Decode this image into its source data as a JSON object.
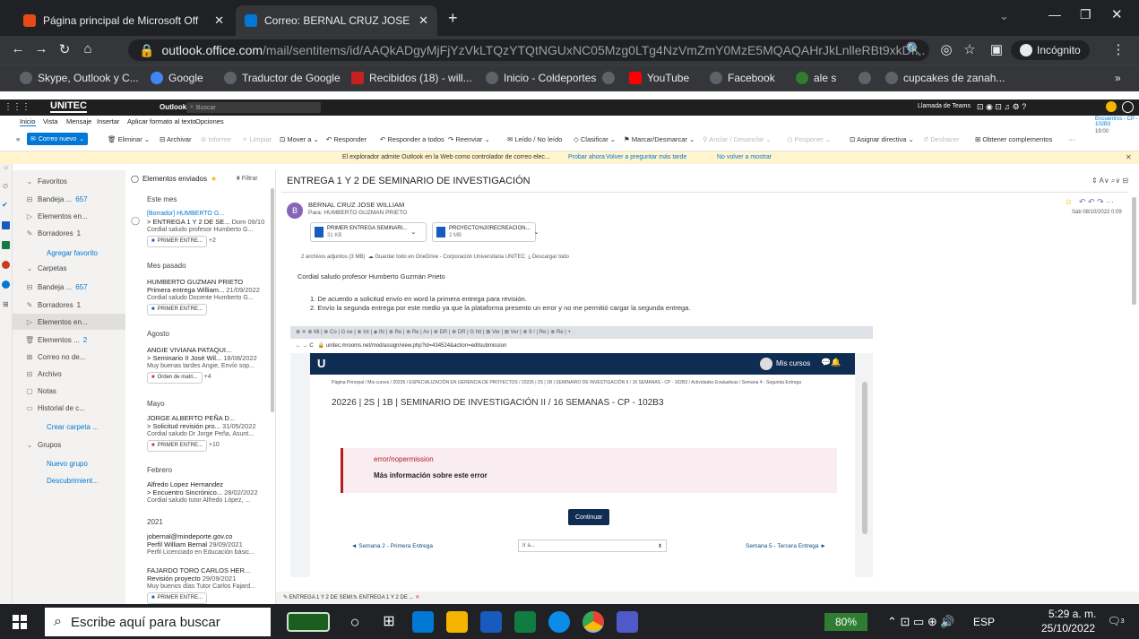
{
  "chrome": {
    "tabs": [
      {
        "title": "Página principal de Microsoft Off",
        "icon": "office-icon"
      },
      {
        "title": "Correo: BERNAL CRUZ JOSE WILL",
        "icon": "outlook-icon"
      }
    ],
    "new_tab": "+",
    "address_host": "outlook.office.com",
    "address_path": "/mail/sentitems/id/AAQkADgyMjFjYzVkLTQzYTQtNGUxNC05Mzg0LTg4NzVmZmY0MzE5MQAQAHrJkLnlleRBt9xkDf...",
    "profile": "Incógnito",
    "bookmarks": [
      "Skype, Outlook y C...",
      "Google",
      "Traductor de Google",
      "Recibidos (18) - will...",
      "Inicio - Coldeportes",
      "YouTube",
      "Facebook",
      "ale s",
      "cupcakes de zanah..."
    ],
    "bookmarks_more": "»"
  },
  "outlook": {
    "brand": "UNITEC",
    "app": "Outlook",
    "search_placeholder": "Buscar",
    "teams_call": "Llamada de Teams",
    "menu_tabs": [
      "Inicio",
      "Vista",
      "Mensaje",
      "Insertar",
      "Aplicar formato al texto",
      "Opciones"
    ],
    "new_mail": "Correo nuevo",
    "ribbon": [
      "Eliminar",
      "Archivar",
      "Informe",
      "Limpiar",
      "Mover a",
      "Responder",
      "Responder a todos",
      "Reenviar",
      "Leído / No leído",
      "Clasificar",
      "Marcar/Desmarcar",
      "Anclar / Desanclar",
      "Posponer",
      "Asignar directiva",
      "Deshacer",
      "Obtener complementos"
    ],
    "reminder": "Encuentros - CP - 102B3",
    "reminder_time": "19:00",
    "info_text": "El explorador admite Outlook en la Web como controlador de correo elec...",
    "info_links": [
      "Probar ahora",
      "Volver a preguntar más tarde",
      "No volver a mostrar"
    ],
    "folders": {
      "favorites_label": "Favoritos",
      "fav_items": [
        {
          "label": "Bandeja ...",
          "count": "657"
        },
        {
          "label": "Elementos en...",
          "count": ""
        },
        {
          "label": "Borradores",
          "count": "1"
        }
      ],
      "add_favorite": "Agregar favorito",
      "carpetas_label": "Carpetas",
      "folder_items": [
        {
          "label": "Bandeja ...",
          "count": "657"
        },
        {
          "label": "Borradores",
          "count": "1"
        },
        {
          "label": "Elementos en...",
          "count": ""
        },
        {
          "label": "Elementos ...",
          "count": "2"
        },
        {
          "label": "Correo no de...",
          "count": ""
        },
        {
          "label": "Archivo",
          "count": ""
        },
        {
          "label": "Notas",
          "count": ""
        },
        {
          "label": "Historial de c...",
          "count": ""
        }
      ],
      "create_folder": "Crear carpeta ...",
      "groups_label": "Grupos",
      "new_group": "Nuevo grupo",
      "discover": "Descubrimient..."
    },
    "list": {
      "header": "Elementos enviados",
      "filter": "Filtrar",
      "groups": [
        "Este mes",
        "Mes pasado",
        "Agosto",
        "Mayo",
        "Febrero",
        "2021"
      ],
      "items": [
        {
          "from": "[Borrador] HUMBERTO G...",
          "subject": "> ENTREGA 1 Y 2 DE SE...",
          "date": "Dom 09/10",
          "preview": "Cordial saludo profesor Humberto G...",
          "attach": "PRIMER ENTRE...",
          "extra": "+2"
        },
        {
          "from": "HUMBERTO GUZMAN PRIETO",
          "subject": "Primera entrega William...",
          "date": "21/09/2022",
          "preview": "Cordial saludo Docente Humberto G...",
          "attach": "PRIMER ENTRE...",
          "extra": ""
        },
        {
          "from": "ANGIE VIVIANA PATAQUI...",
          "subject": "> Seminario II José Wil...",
          "date": "18/08/2022",
          "preview": "Muy buenas tardes Angie, Envío sop...",
          "attach": "Orden de matri...",
          "extra": "+4"
        },
        {
          "from": "JORGE ALBERTO PEÑA D...",
          "subject": "> Solicitud revisión pro...",
          "date": "31/05/2022",
          "preview": "Cordial saludo Dr Jorge Peña, Asunt...",
          "attach": "PRIMER ENTRE...",
          "extra": "+10"
        },
        {
          "from": "Alfredo Lopez Hernandez",
          "subject": "> Encuentro Sincrónico...",
          "date": "28/02/2022",
          "preview": "Cordial saludo tutor Alfredo López, ...",
          "attach": "",
          "extra": ""
        },
        {
          "from": "jobernal@mindeporte.gov.co",
          "subject": "Perfil William Bernal",
          "date": "29/09/2021",
          "preview": "Perfil Licenciado en Educación básic...",
          "attach": "",
          "extra": ""
        },
        {
          "from": "FAJARDO TORO CARLOS HER...",
          "subject": "Revisión proyecto",
          "date": "29/09/2021",
          "preview": "Muy buenos días Tutor Carlos Fajard...",
          "attach": "PRIMER ENTRE...",
          "extra": ""
        }
      ]
    },
    "reading": {
      "subject": "ENTREGA 1 Y 2 DE SEMINARIO DE INVESTIGACIÓN",
      "sender": "BERNAL CRUZ JOSE WILLIAM",
      "avatar": "B",
      "to": "Para: HUMBERTO GUZMAN PRIETO",
      "date": "Sáb 08/10/2022 0:09",
      "attachments": [
        {
          "name": "PRIMER ENTREGA SEMINARI...",
          "size": "31 KB"
        },
        {
          "name": "PROYECTO%20RECREACION...",
          "size": "2 MB"
        }
      ],
      "attach_summary": "2 archivos adjuntos (3 MB)",
      "save_onedrive": "Guardar todo en OneDrive - Corporación Universitaria UNITEC",
      "download_all": "Descargar todo",
      "greeting": "Cordial saludo profesor Humberto Guzmán Prieto",
      "lines": [
        "1. De acuerdo a solicitud envío en word la primera entrega para revisión.",
        "2. Envío la segunda entrega por este medio ya que la plataforma presento un error y no me permitió cargar la segunda entrega."
      ],
      "draft_tabs": [
        "ENTREGA 1 Y 2 DE SEMI...",
        "ENTREGA 1 Y 2 DE ..."
      ]
    },
    "embedded": {
      "url": "unitec.mrooms.net/mod/assign/view.php?id=434524&action=editsubmission",
      "logo": "U",
      "my_courses": "Mis cursos",
      "breadcrumb": "Página Principal / Mis cursos / 20226 / ESPECIALIZACIÓN EN GERENCIA DE PROYECTOS / 20226 | 2S | 1B | SEMINARIO DE INVESTIGACIÓN II / 16 SEMANAS - CP - 102B3 / Actividades Evaluativas / Semana 4 - Segunda Entrega",
      "course_title": "20226 | 2S | 1B | SEMINARIO DE INVESTIGACIÓN II / 16 SEMANAS - CP - 102B3",
      "error_code": "error/nopermission",
      "error_more": "Más información sobre este error",
      "continue": "Continuar",
      "prev_link": "◄ Semana 2 - Primera Entrega",
      "goto": "Ir a...",
      "next_link": "Semana 5 - Tercera Entrega ►"
    }
  },
  "taskbar": {
    "search_placeholder": "Escribe aquí para buscar",
    "battery": "80%",
    "lang": "ESP",
    "time": "5:29 a. m.",
    "date": "25/10/2022",
    "notifications": "3"
  },
  "colors": {
    "accent": "#0078d4",
    "brand": "#1f1f1f",
    "moodle": "#0f2d52",
    "error": "#b41d1d"
  }
}
